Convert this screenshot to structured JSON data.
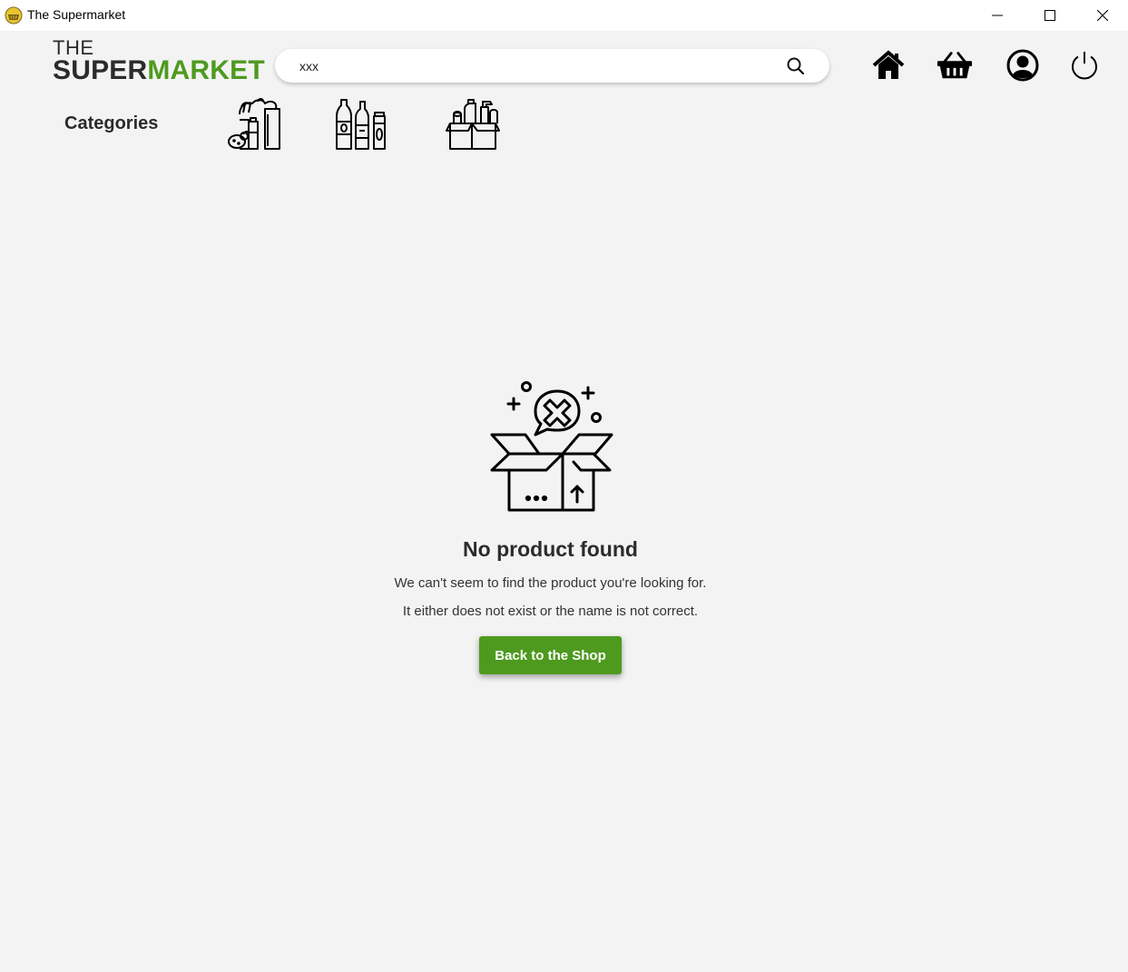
{
  "window": {
    "title": "The Supermarket",
    "controls": [
      "minimize-icon",
      "maximize-icon",
      "close-icon"
    ]
  },
  "header": {
    "logo_the": "THE",
    "logo_super": "SUPER",
    "logo_market": "MARKET",
    "search": {
      "value": "xxx",
      "icon": "search-icon"
    },
    "nav_icons": [
      "home-icon",
      "basket-icon",
      "account-icon",
      "power-icon"
    ]
  },
  "categories": {
    "label": "Categories",
    "items": [
      "groceries-icon",
      "drinks-icon",
      "household-icon"
    ]
  },
  "empty_state": {
    "icon": "empty-box-icon",
    "title": "No product found",
    "line1": "We can't seem to find the product you're looking for.",
    "line2": "It either does not exist or the name is not correct.",
    "button_label": "Back to the Shop"
  },
  "colors": {
    "accent": "#4e9a1f",
    "background": "#f3f3f3",
    "text": "#2b2b2b"
  }
}
